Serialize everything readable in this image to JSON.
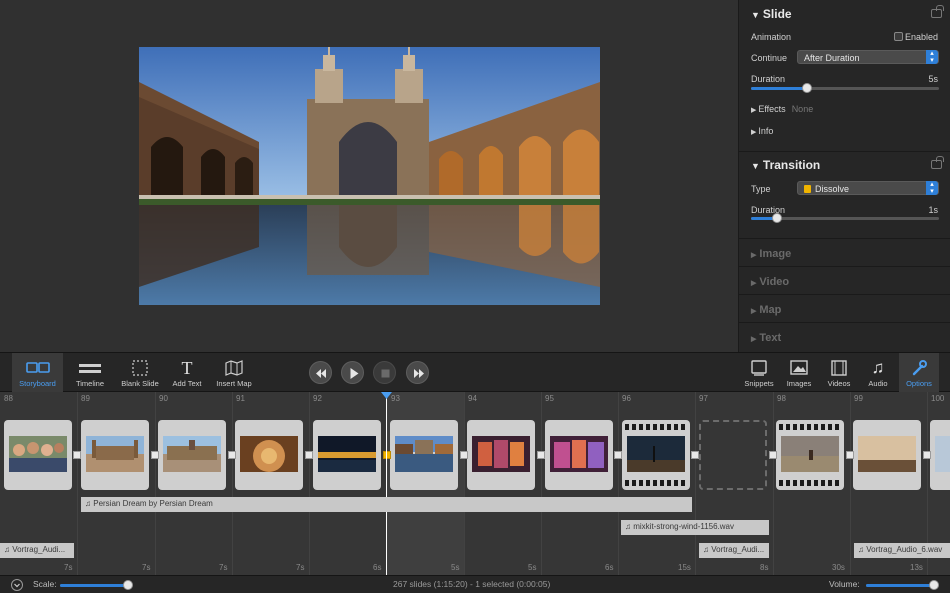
{
  "inspector": {
    "slide": {
      "title": "Slide",
      "animation_label": "Animation",
      "enabled_label": "Enabled",
      "continue_label": "Continue",
      "continue_value": "After Duration",
      "duration_label": "Duration",
      "duration_value": "5s",
      "duration_fraction": 0.3,
      "effects_label": "Effects",
      "effects_value": "None",
      "info_label": "Info"
    },
    "transition": {
      "title": "Transition",
      "type_label": "Type",
      "type_value": "Dissolve",
      "duration_label": "Duration",
      "duration_value": "1s",
      "duration_fraction": 0.14
    },
    "collapsed_sections": [
      "Image",
      "Video",
      "Map",
      "Text"
    ]
  },
  "toolbar": {
    "left": [
      {
        "label": "Storyboard",
        "icon": "storyboard-icon"
      },
      {
        "label": "Timeline",
        "icon": "timeline-icon"
      },
      {
        "label": "Blank Slide",
        "icon": "blank-slide-icon"
      },
      {
        "label": "Add Text",
        "icon": "text-icon"
      },
      {
        "label": "Insert Map",
        "icon": "map-icon"
      }
    ],
    "right": [
      {
        "label": "Snippets",
        "icon": "snippets-icon"
      },
      {
        "label": "Images",
        "icon": "images-icon"
      },
      {
        "label": "Videos",
        "icon": "videos-icon"
      },
      {
        "label": "Audio",
        "icon": "audio-icon"
      },
      {
        "label": "Options",
        "icon": "options-icon"
      }
    ]
  },
  "timeline": {
    "ruler": [
      "88",
      "89",
      "90",
      "91",
      "92",
      "93",
      "94",
      "95",
      "96",
      "97",
      "98",
      "99",
      "100"
    ],
    "durations": [
      "7s",
      "7s",
      "7s",
      "7s",
      "6s",
      "5s",
      "5s",
      "6s",
      "15s",
      "8s",
      "30s",
      "13s"
    ],
    "audio_tracks": {
      "main": "Persian Dream by Persian Dream",
      "wind": "mixkit-strong-wind-1156.wav",
      "vortrag_1": "Vortrag_Audi...",
      "vortrag_2": "Vortrag_Audi...",
      "vortrag_3": "Vortrag_Audio_6.wav"
    }
  },
  "statusbar": {
    "scale_label": "Scale:",
    "status": "267 slides (1:15:20) - 1 selected (0:00:05)",
    "volume_label": "Volume:"
  },
  "colors": {
    "accent": "#2e7fd8",
    "selected_transition": "#f0b400"
  }
}
